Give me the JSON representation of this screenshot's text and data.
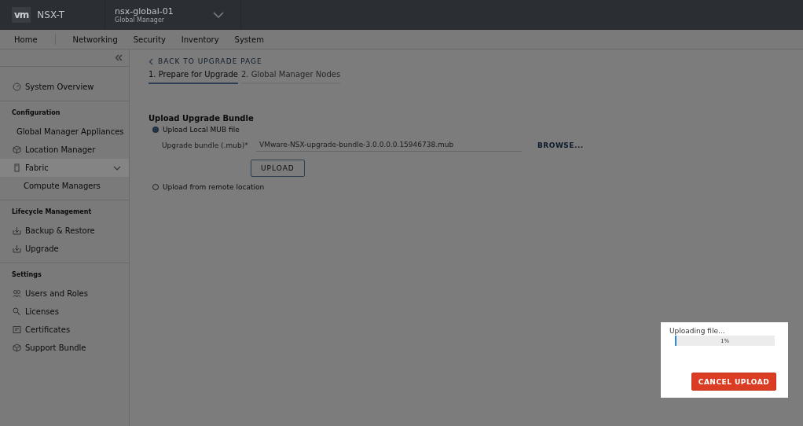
{
  "header": {
    "logo": "vm",
    "product": "NSX-T",
    "instance_name": "nsx-global-01",
    "instance_role": "Global Manager"
  },
  "nav_tabs": [
    {
      "label": "Home"
    },
    {
      "label": "Networking"
    },
    {
      "label": "Security"
    },
    {
      "label": "Inventory"
    },
    {
      "label": "System"
    }
  ],
  "sidebar": {
    "sections": [
      {
        "items": [
          {
            "label": "System Overview"
          }
        ]
      },
      {
        "title": "Configuration",
        "items": [
          {
            "label": "Global Manager Appliances"
          },
          {
            "label": "Location Manager"
          },
          {
            "label": "Fabric",
            "expanded": true,
            "children": [
              {
                "label": "Compute Managers"
              }
            ]
          }
        ]
      },
      {
        "title": "Lifecycle Management",
        "items": [
          {
            "label": "Backup & Restore"
          },
          {
            "label": "Upgrade"
          }
        ]
      },
      {
        "title": "Settings",
        "items": [
          {
            "label": "Users and Roles"
          },
          {
            "label": "Licenses"
          },
          {
            "label": "Certificates"
          },
          {
            "label": "Support Bundle"
          }
        ]
      }
    ]
  },
  "main": {
    "back_link": "BACK TO UPGRADE PAGE",
    "steps": [
      {
        "label": "1. Prepare for Upgrade",
        "selected": true
      },
      {
        "label": "2. Global Manager Nodes",
        "selected": false
      }
    ],
    "section_title": "Upload Upgrade Bundle",
    "options": [
      {
        "label": "Upload Local MUB file",
        "selected": true
      },
      {
        "label": "Upload from remote location",
        "selected": false
      }
    ],
    "field_label": "Upgrade bundle (.mub)*",
    "field_value": "VMware-NSX-upgrade-bundle-3.0.0.0.0.15946738.mub",
    "browse": "BROWSE...",
    "upload": "UPLOAD"
  },
  "dialog": {
    "message": "Uploading file...",
    "level": 0.01,
    "reading": "1%",
    "cancel": "CANCEL UPLOAD"
  }
}
